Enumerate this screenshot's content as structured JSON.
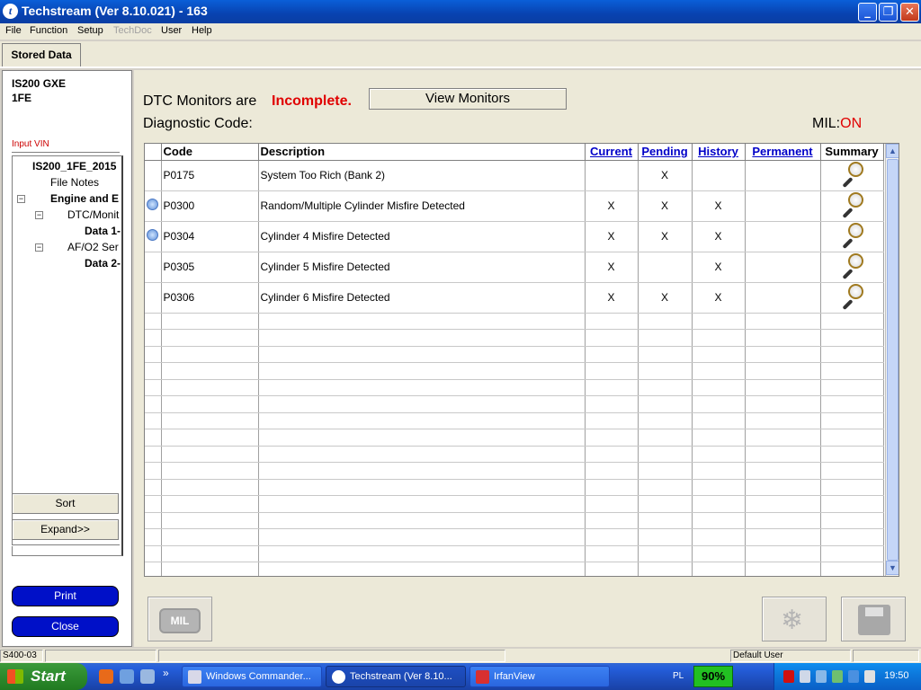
{
  "window": {
    "title": "Techstream (Ver 8.10.021) - 163",
    "min": "_",
    "max": "❐",
    "close": "✕"
  },
  "menu": [
    "File",
    "Function",
    "Setup",
    "TechDoc",
    "User",
    "Help"
  ],
  "tab": "Stored Data",
  "vehicle": {
    "model": "IS200 GXE",
    "engine": "1FE"
  },
  "input_vin": "Input VIN",
  "tree": {
    "root": "IS200_1FE_2015",
    "file_notes": "File Notes",
    "engine": "Engine and E",
    "dtc": "DTC/Monit",
    "data1": "Data 1-",
    "afo2": "AF/O2 Ser",
    "data2": "Data 2-"
  },
  "buttons": {
    "sort": "Sort",
    "expand": "Expand>>",
    "print": "Print",
    "close": "Close",
    "view_monitors": "View Monitors"
  },
  "status": {
    "dtc_monitors_label": "DTC Monitors are",
    "dtc_monitors_value": "Incomplete.",
    "diagnostic_code_label": "Diagnostic Code:",
    "mil_label": "MIL:",
    "mil_value": "ON"
  },
  "table": {
    "headers": {
      "code": "Code",
      "description": "Description",
      "current": "Current",
      "pending": "Pending",
      "history": "History",
      "permanent": "Permanent",
      "summary": "Summary"
    },
    "rows": [
      {
        "freeze": false,
        "code": "P0175",
        "description": "System Too Rich (Bank 2)",
        "current": "",
        "pending": "X",
        "history": "",
        "permanent": ""
      },
      {
        "freeze": true,
        "code": "P0300",
        "description": "Random/Multiple Cylinder Misfire Detected",
        "current": "X",
        "pending": "X",
        "history": "X",
        "permanent": ""
      },
      {
        "freeze": true,
        "code": "P0304",
        "description": "Cylinder 4 Misfire Detected",
        "current": "X",
        "pending": "X",
        "history": "X",
        "permanent": ""
      },
      {
        "freeze": false,
        "code": "P0305",
        "description": "Cylinder 5 Misfire Detected",
        "current": "X",
        "pending": "",
        "history": "X",
        "permanent": ""
      },
      {
        "freeze": false,
        "code": "P0306",
        "description": "Cylinder 6 Misfire Detected",
        "current": "X",
        "pending": "X",
        "history": "X",
        "permanent": ""
      }
    ],
    "empty_rows": 16
  },
  "bottom_icons": {
    "mil_icon": "MIL",
    "freeze_icon": "snowflake-icon",
    "save_icon": "floppy-disk-icon"
  },
  "statusbar": {
    "code": "S400-03",
    "user": "Default User"
  },
  "taskbar": {
    "start": "Start",
    "tasks": [
      {
        "label": "Windows Commander..."
      },
      {
        "label": "Techstream (Ver 8.10..."
      },
      {
        "label": "IrfanView"
      }
    ],
    "overflow": "»",
    "lang": "PL",
    "battery": "90%",
    "clock": "19:50"
  },
  "colors": {
    "accent_red": "#e00000",
    "link_blue": "#0000c8",
    "button_blue": "#0010c8"
  }
}
